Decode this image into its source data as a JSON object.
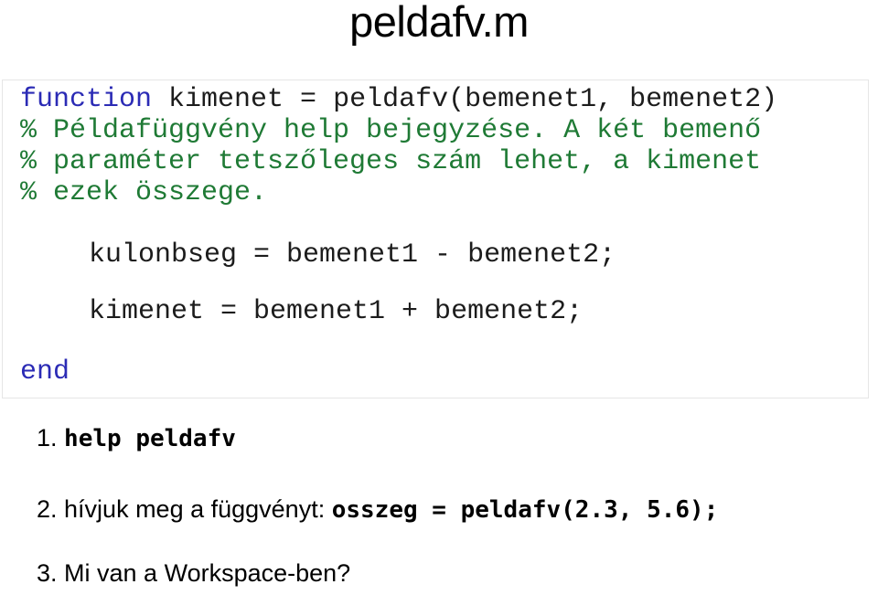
{
  "slide": {
    "title": "peldafv.m",
    "background_color": "#ffffff",
    "text_color": "#000000"
  },
  "code_block": {
    "border_color": "#e6e6e6",
    "keyword_color": "#2b2bb5",
    "comment_color": "#1f7a35",
    "code_color": "#1c1c1c",
    "lines": [
      {
        "id": "code-l0",
        "segments": [
          {
            "text": "function",
            "style": "keyword"
          },
          {
            "text": " kimenet = peldafv(bemenet1, bemenet2)",
            "style": "code"
          }
        ],
        "plain": "function kimenet = peldafv(bemenet1, bemenet2)"
      },
      {
        "id": "code-l1",
        "segments": [
          {
            "text": "% Példafüggvény help bejegyzése. A két bemenő",
            "style": "comment"
          }
        ],
        "plain": "% Példafüggvény help bejegyzése. A két bemenő"
      },
      {
        "id": "code-l2",
        "segments": [
          {
            "text": "% paraméter tetszőleges szám lehet, a kimenet",
            "style": "comment"
          }
        ],
        "plain": "% paraméter tetszőleges szám lehet, a kimenet"
      },
      {
        "id": "code-l3",
        "segments": [
          {
            "text": "% ezek összege.",
            "style": "comment"
          }
        ],
        "plain": "% ezek összege."
      },
      {
        "id": "code-l4",
        "segments": [
          {
            "text": "kulonbseg = bemenet1 - bemenet2;",
            "style": "code"
          }
        ],
        "plain": "kulonbseg = bemenet1 - bemenet2;"
      },
      {
        "id": "code-l5",
        "segments": [
          {
            "text": "kimenet = bemenet1 + bemenet2;",
            "style": "code"
          }
        ],
        "plain": "kimenet = bemenet1 + bemenet2;"
      },
      {
        "id": "code-l6",
        "segments": [
          {
            "text": "end",
            "style": "keyword"
          }
        ],
        "plain": "end"
      }
    ]
  },
  "tasks": [
    {
      "number": "1.",
      "prefix": " ",
      "code": "help peldafv",
      "suffix": ""
    },
    {
      "number": "2.",
      "prefix": " hívjuk meg a függvényt: ",
      "code": "osszeg = peldafv(2.3, 5.6);",
      "suffix": ""
    },
    {
      "number": "3.",
      "prefix": " Mi van a Workspace-ben?",
      "code": "",
      "suffix": ""
    }
  ]
}
